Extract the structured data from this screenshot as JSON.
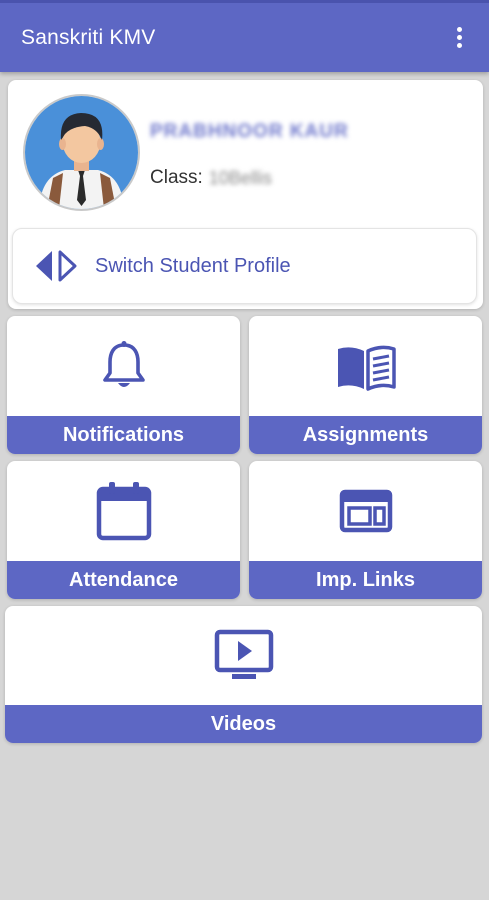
{
  "app_bar": {
    "title": "Sanskriti KMV",
    "menu_icon": "more-vertical-icon"
  },
  "profile": {
    "avatar_icon": "student-avatar",
    "name": "PRABHNOOR KAUR",
    "class_label": "Class:",
    "class_value": "10Bellis",
    "switch_icon": "switch-arrows-icon",
    "switch_label": "Switch Student Profile"
  },
  "tiles": [
    {
      "label": "Notifications",
      "icon": "bell-icon"
    },
    {
      "label": "Assignments",
      "icon": "book-open-icon"
    },
    {
      "label": "Attendance",
      "icon": "calendar-icon"
    },
    {
      "label": "Imp. Links",
      "icon": "web-links-icon"
    },
    {
      "label": "Videos",
      "icon": "video-play-icon"
    }
  ],
  "colors": {
    "primary": "#5d67c4",
    "background": "#d6d6d6",
    "card": "#ffffff",
    "icon": "#4b55b3"
  }
}
